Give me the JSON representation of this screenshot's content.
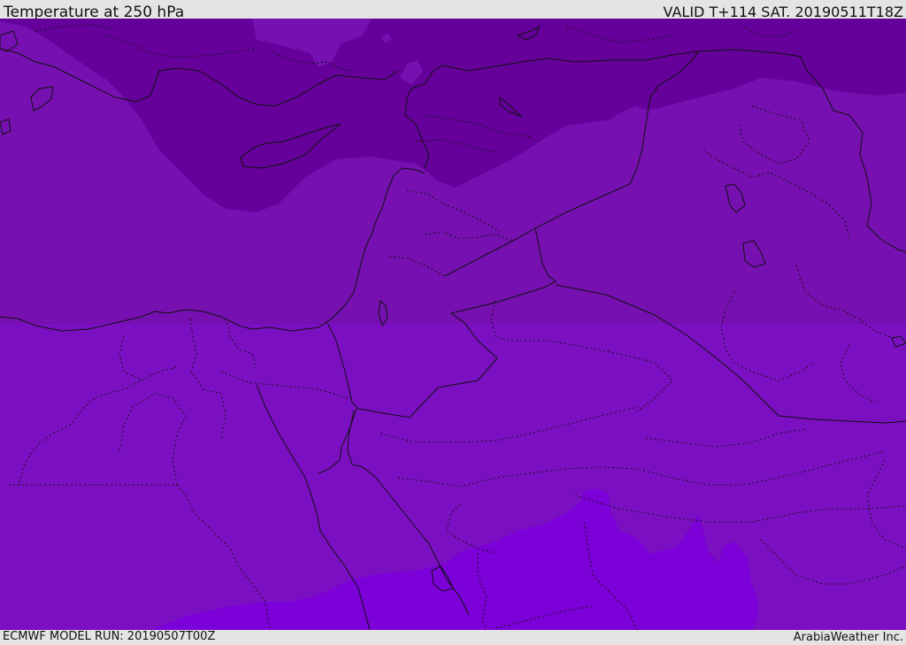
{
  "header": {
    "title": "Temperature at 250 hPa",
    "valid": "VALID T+114 SAT. 20190511T18Z"
  },
  "footer": {
    "model_run": "ECMWF MODEL RUN: 20190507T00Z",
    "credit": "ArabiaWeather Inc."
  },
  "colors": {
    "band_cold": "#65019a",
    "band_mid": "#7610b0",
    "band_lower": "#7b10c2",
    "band_warm": "#7c00d8",
    "coastline": "#111111",
    "frame": "#e4e4e4"
  }
}
